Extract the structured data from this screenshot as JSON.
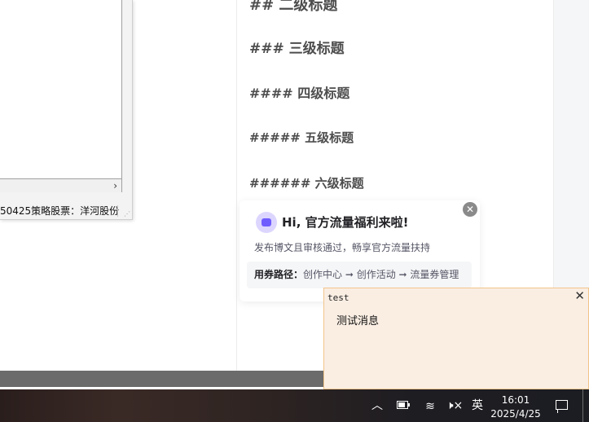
{
  "left_window": {
    "scroll_arrow": "›",
    "status_text": "50425策略股票：洋河股份",
    "resize_grip": "⋰"
  },
  "article": {
    "headings": {
      "h2": "## 二级标题",
      "h3": "### 三级标题",
      "h4": "#### 四级标题",
      "h5": "##### 五级标题",
      "h6": "###### 六级标题"
    },
    "promo": {
      "title": "Hi, 官方流量福利来啦!",
      "subtitle": "发布博文且审核通过，畅享官方流量扶持",
      "path_label": "用券路径：",
      "path_value": "创作中心 ➞ 创作活动 ➞ 流量券管理",
      "close_glyph": "✕"
    }
  },
  "notification": {
    "title": "test",
    "message": "测试消息",
    "close_glyph": "✕"
  },
  "taskbar": {
    "chevron": "︿",
    "network_glyph": "≋",
    "volume_glyph": "🕨×",
    "ime": "英",
    "time": "16:01",
    "date": "2025/4/25"
  },
  "colors": {
    "notification_bg": "#faeee3",
    "notification_border": "#f2c48a",
    "heading_text": "#4d4d4d",
    "taskbar_bg": "#1e1d22"
  }
}
